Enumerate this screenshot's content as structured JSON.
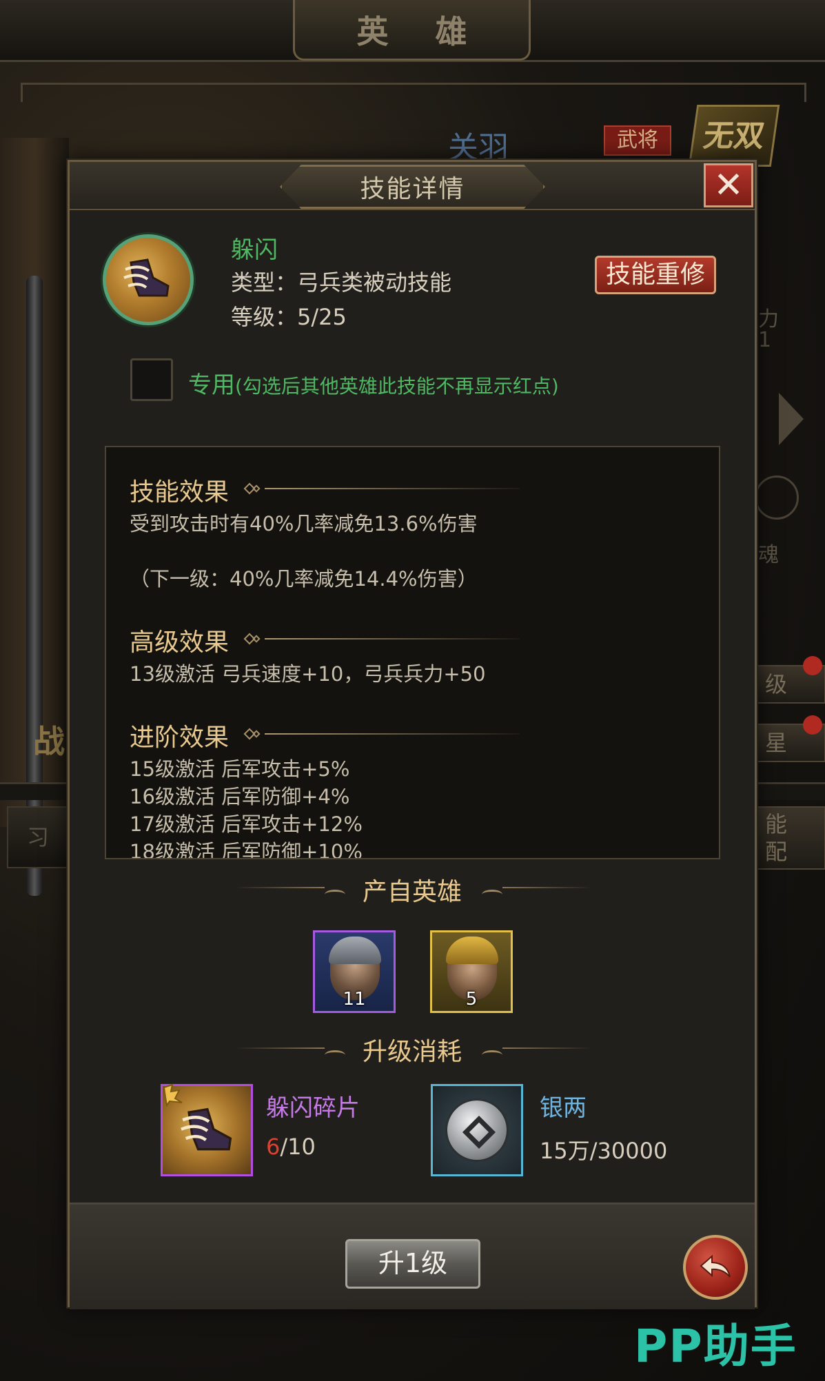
{
  "screen": {
    "title": "英 雄",
    "hero_name": "关羽",
    "hero_tag": "武将",
    "badge": "无双",
    "side_texts": [
      "力",
      "1",
      "魂",
      "级",
      "星",
      "能",
      "配",
      "战",
      "习"
    ]
  },
  "modal": {
    "title": "技能详情",
    "close_icon": "close-icon",
    "skill": {
      "name": "躲闪",
      "type": "类型：弓兵类被动技能",
      "level": "等级：5/25",
      "relearn_label": "技能重修"
    },
    "exclusive": {
      "label": "专用",
      "note": "(勾选后其他英雄此技能不再显示红点)"
    },
    "effects": {
      "skill_effect_title": "技能效果",
      "skill_effect_text": "受到攻击时有40%几率减免13.6%伤害",
      "next_level_text": "（下一级：40%几率减免14.4%伤害）",
      "advanced_title": "高级效果",
      "advanced_text": "13级激活 弓兵速度+10，弓兵兵力+50",
      "promotion_title": "进阶效果",
      "promotion_lines": [
        "15级激活 后军攻击+5%",
        "16级激活 后军防御+4%",
        "17级激活 后军攻击+12%",
        "18级激活 后军防御+10%"
      ]
    },
    "source_heroes": {
      "title": "产自英雄",
      "heroes": [
        {
          "level": "11",
          "frame": "purple"
        },
        {
          "level": "5",
          "frame": "gold"
        }
      ]
    },
    "upgrade_cost": {
      "title": "升级消耗",
      "items": [
        {
          "name": "躲闪碎片",
          "have": "6",
          "need": "/10",
          "name_color": "#c67ae8"
        },
        {
          "name": "银两",
          "amount": "15万/30000",
          "name_color": "#6fb4e0"
        }
      ]
    },
    "upgrade_button": "升1级",
    "back_icon": "back-arrow-icon"
  },
  "watermark": "PP助手"
}
